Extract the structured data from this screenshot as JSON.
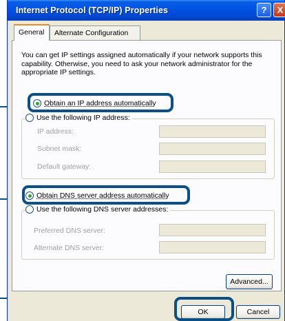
{
  "window": {
    "title": "Internet Protocol (TCP/IP) Properties",
    "help_label": "?",
    "close_label": "X"
  },
  "tabs": [
    {
      "label": "General",
      "active": true
    },
    {
      "label": "Alternate Configuration",
      "active": false
    }
  ],
  "description": "You can get IP settings assigned automatically if your network supports this capability. Otherwise, you need to ask your network administrator for the appropriate IP settings.",
  "ip_section": {
    "auto_label": "Obtain an IP address automatically",
    "auto_selected": true,
    "manual_label": "Use the following IP address:",
    "fields": [
      {
        "label": "IP address:",
        "value": ""
      },
      {
        "label": "Subnet mask:",
        "value": ""
      },
      {
        "label": "Default gateway:",
        "value": ""
      }
    ]
  },
  "dns_section": {
    "auto_label": "Obtain DNS server address automatically",
    "auto_selected": true,
    "manual_label": "Use the following DNS server addresses:",
    "fields": [
      {
        "label": "Preferred DNS server:",
        "value": ""
      },
      {
        "label": "Alternate DNS server:",
        "value": ""
      }
    ]
  },
  "buttons": {
    "advanced": "Advanced...",
    "ok": "OK",
    "cancel": "Cancel"
  },
  "colors": {
    "titlebar": "#0054e3",
    "callout": "#0a4f86",
    "radio_dot": "#2fa52f"
  }
}
